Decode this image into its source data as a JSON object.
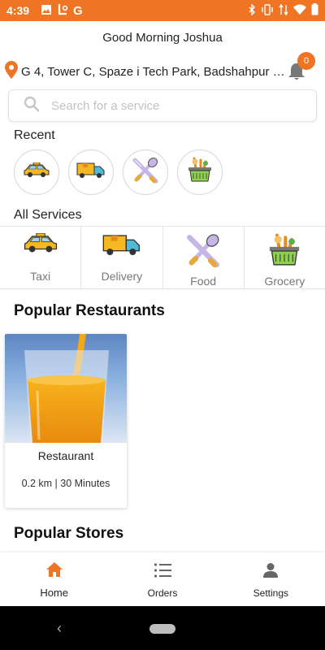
{
  "status_bar": {
    "time": "4:39",
    "left_icons": [
      "image-icon",
      "app-icon",
      "google-icon"
    ],
    "right_icons": [
      "bluetooth-icon",
      "vibrate-icon",
      "data-icon",
      "wifi-icon",
      "battery-icon"
    ],
    "color": "#ef7423"
  },
  "header": {
    "greeting": "Good Morning Joshua",
    "location": "G 4, Tower C, Spaze i Tech Park, Badshahpur S...",
    "notification_count": "0"
  },
  "search": {
    "placeholder": "Search for a service"
  },
  "recent": {
    "label": "Recent",
    "items": [
      "taxi-icon",
      "delivery-icon",
      "food-icon",
      "grocery-icon"
    ]
  },
  "all_services": {
    "label": "All Services",
    "items": [
      {
        "label": "Taxi",
        "icon": "taxi-icon"
      },
      {
        "label": "Delivery",
        "icon": "delivery-icon"
      },
      {
        "label": "Food",
        "icon": "food-icon"
      },
      {
        "label": "Grocery",
        "icon": "grocery-icon"
      }
    ]
  },
  "popular_restaurants": {
    "title": "Popular Restaurants",
    "cards": [
      {
        "name": "Restaurant",
        "meta": "0.2 km | 30 Minutes"
      }
    ]
  },
  "popular_stores": {
    "title": "Popular Stores"
  },
  "bottom_nav": {
    "items": [
      {
        "label": "Home",
        "icon": "home-icon",
        "active": true
      },
      {
        "label": "Orders",
        "icon": "list-icon",
        "active": false
      },
      {
        "label": "Settings",
        "icon": "person-icon",
        "active": false
      }
    ],
    "active_color": "#ef7423"
  }
}
